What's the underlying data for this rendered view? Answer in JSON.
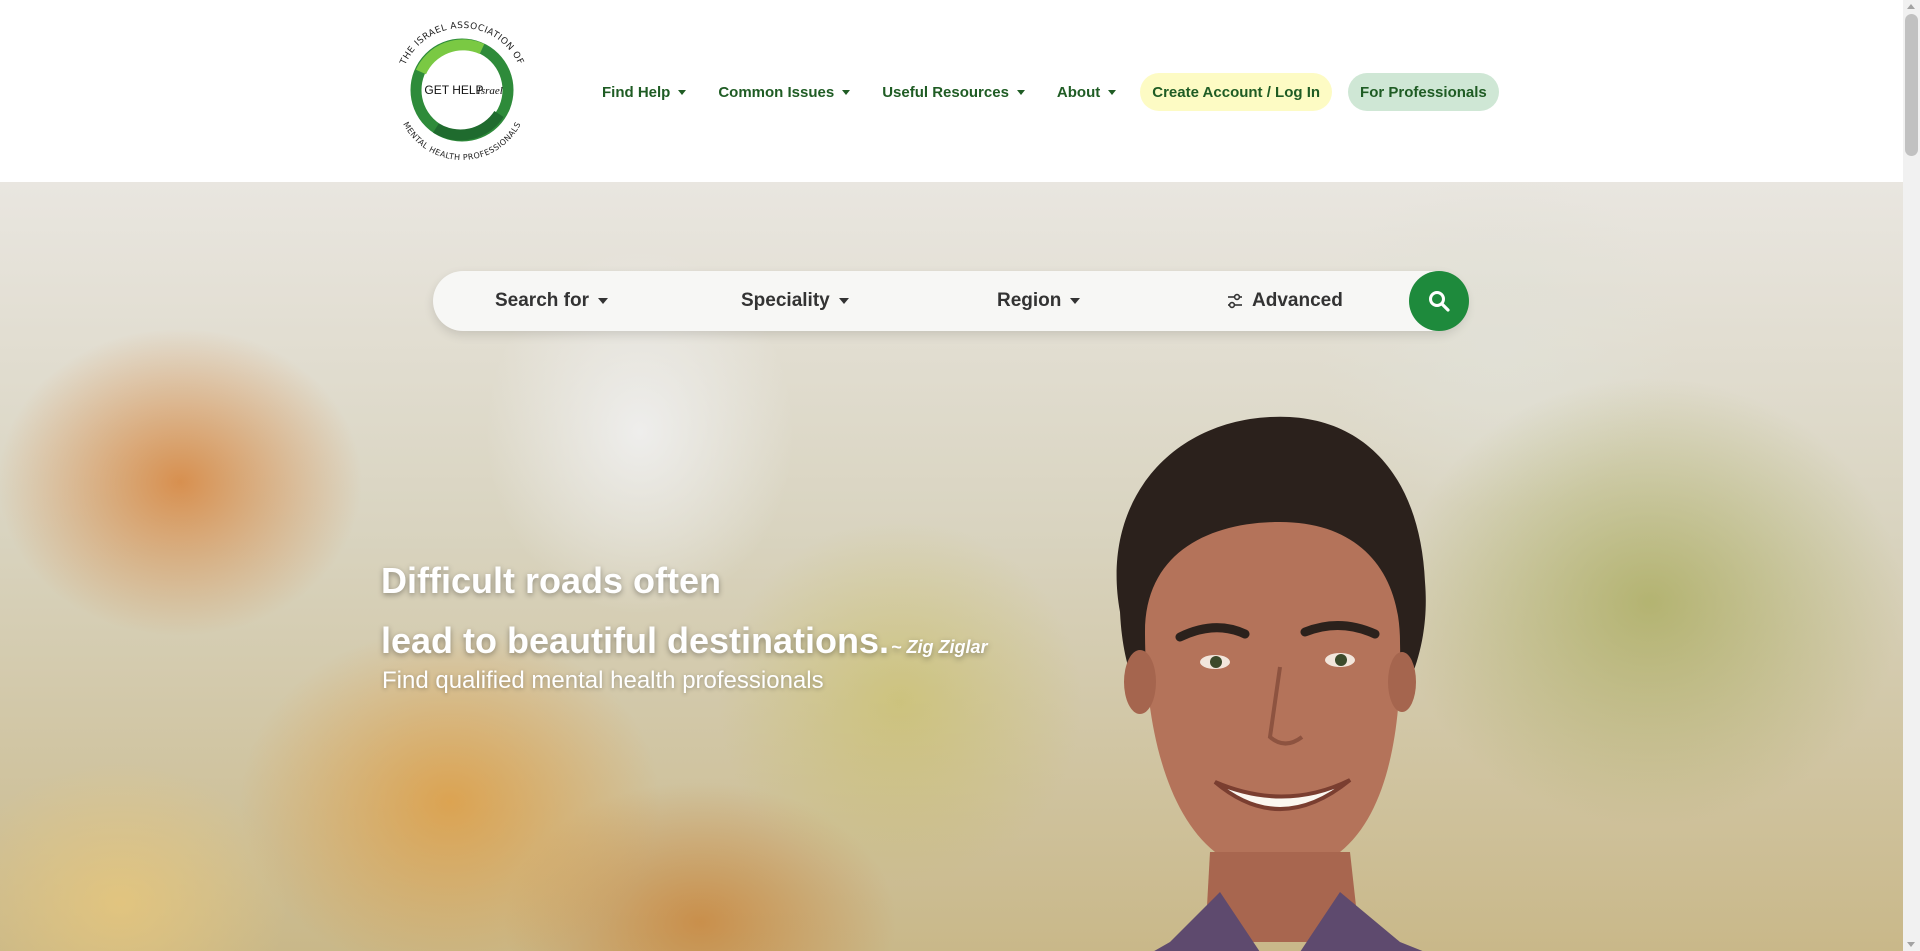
{
  "logo": {
    "ring_text_top": "THE ISRAEL ASSOCIATION OF",
    "ring_text_bottom": "MENTAL HEALTH PROFESSIONALS",
    "center_text": "GET HELP",
    "center_script": "Israel",
    "color_dark_green": "#1f6b2e",
    "color_light_green": "#6cbf3e"
  },
  "nav": {
    "items": [
      {
        "label": "Find Help"
      },
      {
        "label": "Common Issues"
      },
      {
        "label": "Useful Resources"
      },
      {
        "label": "About"
      }
    ],
    "login_label": "Create Account / Log In",
    "professionals_label": "For Professionals",
    "text_color": "#1f5c24",
    "login_bg": "#fdfbc4",
    "professionals_bg": "#cfe7d5"
  },
  "search": {
    "search_for_label": "Search for",
    "speciality_label": "Speciality",
    "region_label": "Region",
    "advanced_label": "Advanced",
    "button_icon": "search-icon",
    "button_color": "#1e8a3c"
  },
  "hero": {
    "quote_line1": "Difficult roads often",
    "quote_line2": "lead to beautiful destinations.",
    "author": "~ Zig Ziglar",
    "subtitle": "Find qualified mental health professionals"
  }
}
